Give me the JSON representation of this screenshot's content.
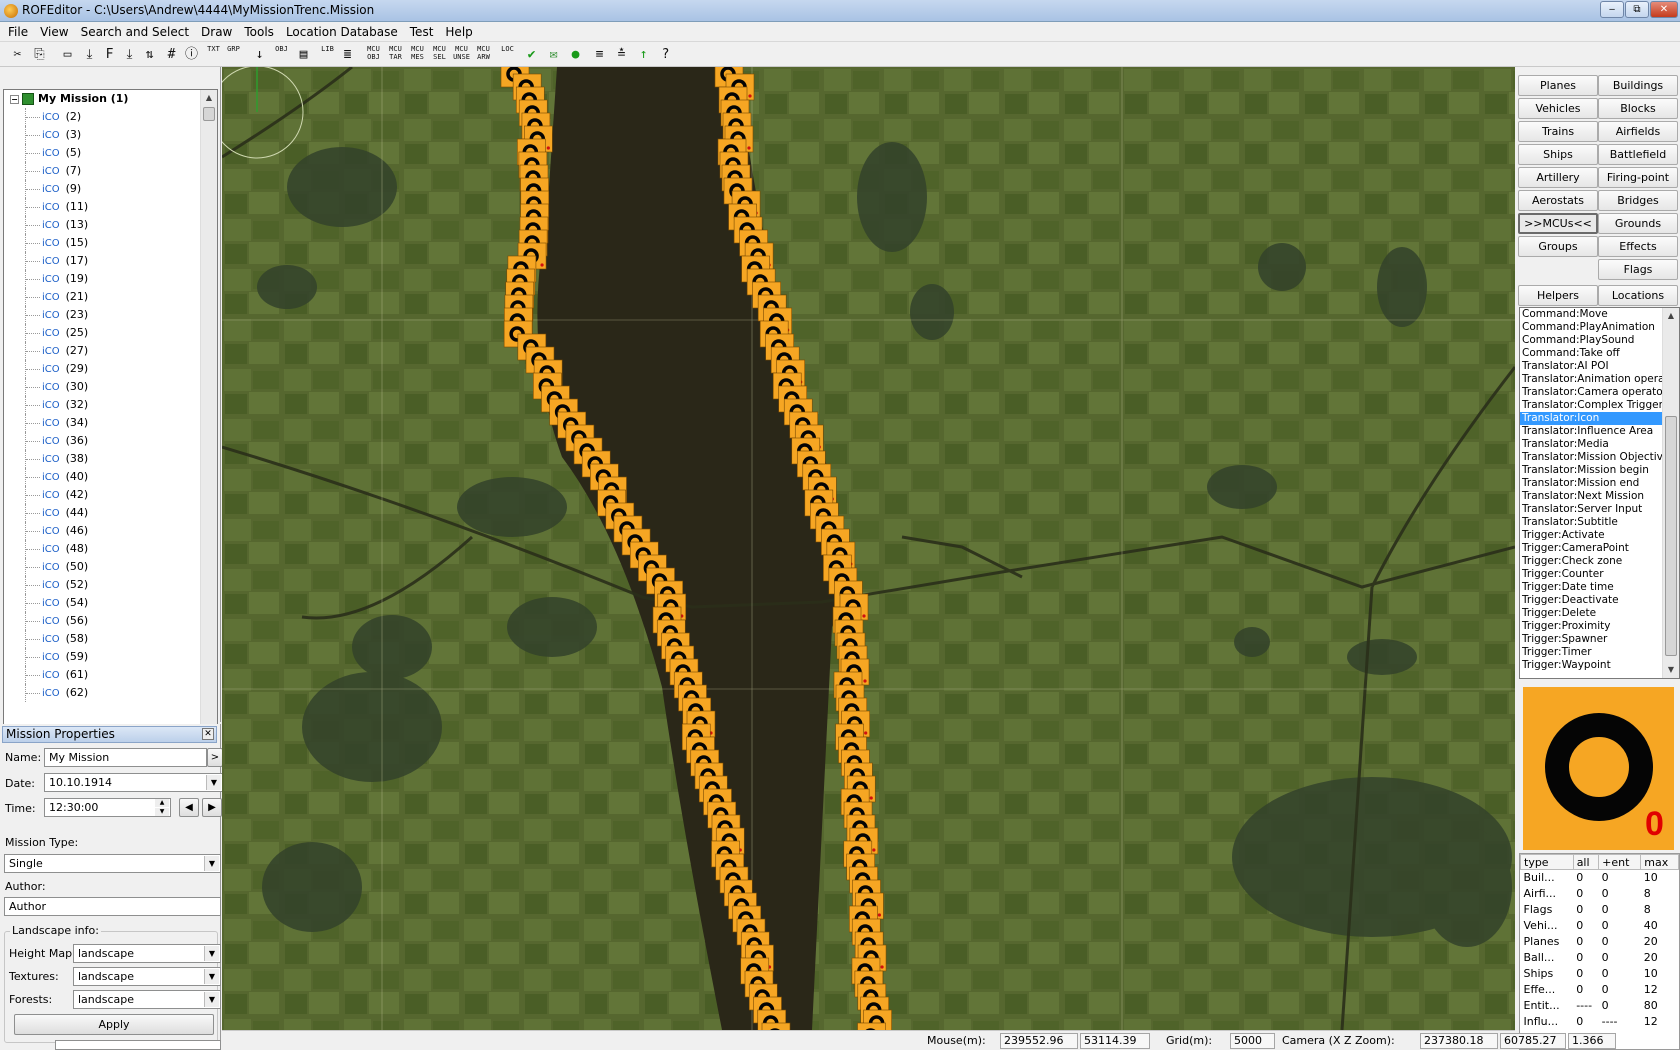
{
  "window": {
    "title": "ROFEditor - C:\\Users\\Andrew\\4444\\MyMissionTrenc.Mission",
    "minimize": "‒",
    "maximize": "⧉",
    "close": "✕"
  },
  "menu": [
    "File",
    "View",
    "Search and Select",
    "Draw",
    "Tools",
    "Location Database",
    "Test",
    "Help"
  ],
  "toolbar": {
    "buttons": [
      {
        "icon": "cut-icon",
        "label": "✂"
      },
      {
        "icon": "copy-icon",
        "label": "⎘"
      },
      {
        "icon": "ruler-icon",
        "label": "▭"
      },
      {
        "icon": "import-icon",
        "label": "⤓"
      },
      {
        "icon": "font-icon",
        "label": "F"
      },
      {
        "icon": "export-icon",
        "label": "⤓"
      },
      {
        "icon": "sort-icon",
        "label": "⇅"
      },
      {
        "icon": "grid-icon",
        "label": "#"
      },
      {
        "icon": "info-icon",
        "label": "ⓘ"
      },
      {
        "icon": "text-obj-icon",
        "label": "TXT"
      },
      {
        "icon": "grp-obj-icon",
        "label": "GRP"
      },
      {
        "icon": "marker-icon",
        "label": "↓"
      },
      {
        "icon": "obj-fnt-icon",
        "label": "OBJ"
      },
      {
        "icon": "obj-icon",
        "label": "▤"
      },
      {
        "icon": "lib-icon",
        "label": "LIB"
      },
      {
        "icon": "layers-icon",
        "label": "≣"
      },
      {
        "icon": "mcu-obj-icon",
        "label": "MCU OBJ"
      },
      {
        "icon": "mcu-tar-icon",
        "label": "MCU TAR"
      },
      {
        "icon": "mcu-mes-icon",
        "label": "MCU MES"
      },
      {
        "icon": "mcu-sel-icon",
        "label": "MCU SEL"
      },
      {
        "icon": "mcu-unse-icon",
        "label": "MCU UNSE"
      },
      {
        "icon": "mcu-arw-icon",
        "label": "MCU ARW"
      },
      {
        "icon": "loc-icon",
        "label": "LOC"
      },
      {
        "icon": "check-icon",
        "label": "✔"
      },
      {
        "icon": "envelope-icon",
        "label": "✉"
      },
      {
        "icon": "green-dot-icon",
        "label": "●"
      },
      {
        "icon": "align-icon",
        "label": "≡"
      },
      {
        "icon": "distribute-icon",
        "label": "≛"
      },
      {
        "icon": "arrow-up-icon",
        "label": "↑"
      },
      {
        "icon": "help-icon",
        "label": "?"
      }
    ]
  },
  "tree": {
    "root_label": "My Mission (1)",
    "expander": "−",
    "item_prefix": "iCO",
    "items": [
      "(2)",
      "(3)",
      "(5)",
      "(7)",
      "(9)",
      "(11)",
      "(13)",
      "(15)",
      "(17)",
      "(19)",
      "(21)",
      "(23)",
      "(25)",
      "(27)",
      "(29)",
      "(30)",
      "(32)",
      "(34)",
      "(36)",
      "(38)",
      "(40)",
      "(42)",
      "(44)",
      "(46)",
      "(48)",
      "(50)",
      "(52)",
      "(54)",
      "(56)",
      "(58)",
      "(59)",
      "(61)",
      "(62)"
    ]
  },
  "scroll_arrows": {
    "up": "▲",
    "down": "▼"
  },
  "mission_properties": {
    "header": "Mission Properties",
    "close": "✕",
    "name_label": "Name:",
    "name_value": "My Mission",
    "name_button": ">",
    "date_label": "Date:",
    "date_value": "10.10.1914",
    "time_label": "Time:",
    "time_value": "12:30:00",
    "prev_button": "◀",
    "next_button": "▶",
    "type_label": "Mission Type:",
    "type_value": "Single",
    "author_label": "Author:",
    "author_value": "Author",
    "landscape_label": "Landscape info:",
    "heightmap_label": "Height Map:",
    "heightmap_value": "landscape",
    "textures_label": "Textures:",
    "textures_value": "landscape",
    "forests_label": "Forests:",
    "forests_value": "landscape",
    "apply_label": "Apply",
    "dropdown_arrow": "▼",
    "spin_up": "▲",
    "spin_down": "▼"
  },
  "right_buttons": [
    [
      "Planes",
      "Buildings"
    ],
    [
      "Vehicles",
      "Blocks"
    ],
    [
      "Trains",
      "Airfields"
    ],
    [
      "Ships",
      "Battlefield"
    ],
    [
      "Artillery",
      "Firing-point"
    ],
    [
      "Aerostats",
      "Bridges"
    ],
    [
      ">>MCUs<<",
      "Grounds"
    ],
    [
      "Groups",
      "Effects"
    ],
    [
      "",
      "Flags"
    ],
    [
      "Helpers",
      "Locations"
    ]
  ],
  "mcu_list": {
    "selected_index": 8,
    "items": [
      "Command:Move",
      "Command:PlayAnimation",
      "Command:PlaySound",
      "Command:Take off",
      "Translator:AI POI",
      "Translator:Animation operato",
      "Translator:Camera operator",
      "Translator:Complex Trigger",
      "Translator:Icon",
      "Translator:Influence Area",
      "Translator:Media",
      "Translator:Mission Objective",
      "Translator:Mission begin",
      "Translator:Mission end",
      "Translator:Next Mission",
      "Translator:Server Input",
      "Translator:Subtitle",
      "Trigger:Activate",
      "Trigger:CameraPoint",
      "Trigger:Check zone",
      "Trigger:Counter",
      "Trigger:Date time",
      "Trigger:Deactivate",
      "Trigger:Delete",
      "Trigger:Proximity",
      "Trigger:Spawner",
      "Trigger:Timer",
      "Trigger:Waypoint"
    ]
  },
  "preview": {
    "badge": "0",
    "bg_color": "#f6a623"
  },
  "stats": {
    "headers": [
      "type",
      "all",
      "+ent",
      "max"
    ],
    "rows": [
      [
        "Buil...",
        "0",
        "0",
        "10"
      ],
      [
        "Airfi...",
        "0",
        "0",
        "8"
      ],
      [
        "Flags",
        "0",
        "0",
        "8"
      ],
      [
        "Vehi...",
        "0",
        "0",
        "40"
      ],
      [
        "Planes",
        "0",
        "0",
        "20"
      ],
      [
        "Ball...",
        "0",
        "0",
        "20"
      ],
      [
        "Ships",
        "0",
        "0",
        "10"
      ],
      [
        "Effe...",
        "0",
        "0",
        "12"
      ],
      [
        "Entit...",
        "----",
        "0",
        "80"
      ],
      [
        "Influ...",
        "0",
        "----",
        "12"
      ]
    ]
  },
  "status": {
    "mouse_label": "Mouse(m):",
    "mouse_x": "239552.96",
    "mouse_z": "53114.39",
    "grid_label": "Grid(m):",
    "grid_value": "5000",
    "camera_label": "Camera (X  Z  Zoom):",
    "camera_x": "237380.18",
    "camera_z": "60785.27",
    "camera_zoom": "1.366"
  },
  "colors": {
    "icon_orange": "#f6a623",
    "water": "#2a2718",
    "selection": "#3399ff"
  }
}
